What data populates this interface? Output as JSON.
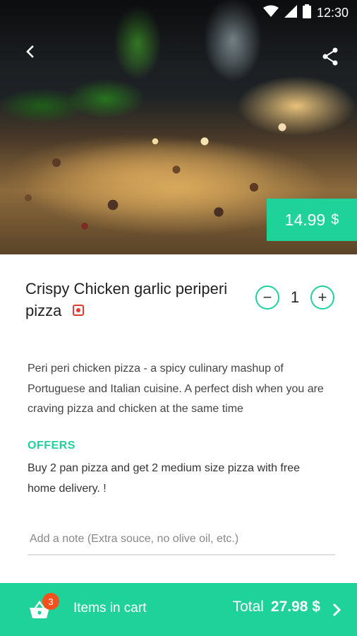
{
  "status_bar": {
    "time": "12:30",
    "icons": [
      "wifi-icon",
      "cell-signal-icon",
      "battery-icon"
    ]
  },
  "header": {
    "back_icon": "arrow-back-icon",
    "share_icon": "share-icon"
  },
  "product": {
    "price": "14.99",
    "currency": "$",
    "name": "Crispy Chicken garlic periperi pizza",
    "type_marker": "non-veg-indicator-icon",
    "quantity": "1",
    "decrease_label": "−",
    "increase_label": "+",
    "description": "Peri peri chicken pizza - a spicy culinary mashup of Portuguese and Italian cuisine. A perfect dish when you are craving pizza and chicken at the same time",
    "offers_heading": "OFFERS",
    "offers_text": "Buy 2 pan pizza and get 2 medium size pizza with free home delivery. !"
  },
  "note": {
    "placeholder": "Add a note (Extra souce, no olive oil, etc.)",
    "value": ""
  },
  "cart": {
    "count": "3",
    "label": "Items in cart",
    "total_label": "Total",
    "total_amount": "27.98 $"
  },
  "colors": {
    "accent": "#1fd29a",
    "badge": "#f4511e",
    "veg_mark": "#e53935"
  }
}
